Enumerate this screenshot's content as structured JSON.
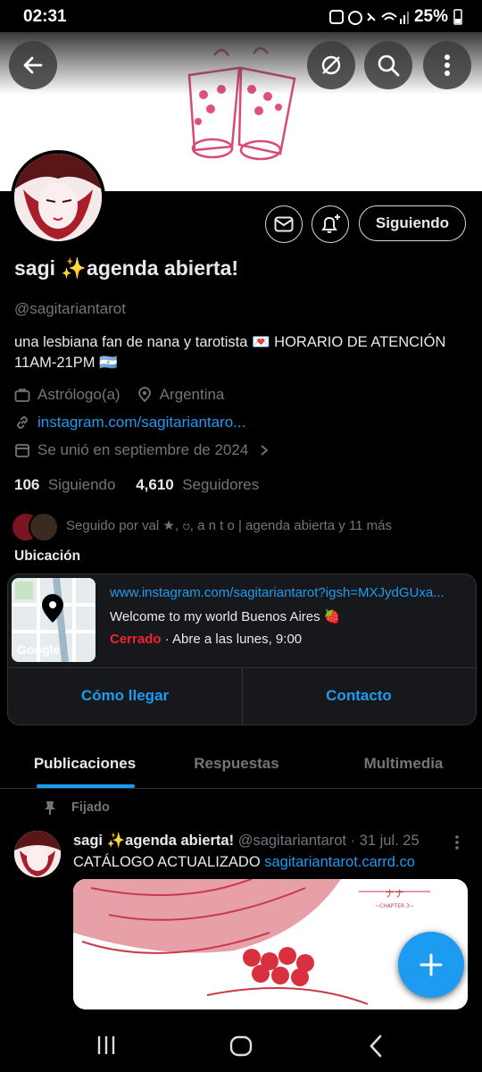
{
  "status_bar": {
    "time": "02:31",
    "battery": "25%"
  },
  "profile": {
    "display_name": "sagi ✨agenda abierta!",
    "handle": "@sagitariantarot",
    "bio": "una lesbiana fan de nana y tarotista 💌 HORARIO DE ATENCIÓN 11AM-21PM 🇦🇷",
    "category": "Astrólogo(a)",
    "location": "Argentina",
    "website": "instagram.com/sagitariantaro...",
    "joined": "Se unió en septiembre de 2024",
    "following_count": "106",
    "following_label": "Siguiendo",
    "followers_count": "4,610",
    "followers_label": "Seguidores",
    "followed_by": "Seguido por val ★, ဗ, a n t o | agenda abierta y 11 más",
    "follow_button": "Siguiendo"
  },
  "location_card": {
    "section_title": "Ubicación",
    "url": "www.instagram.com/sagitariantarot?igsh=MXJydGUxa...",
    "description": "Welcome to my world  Buenos Aires 🍓",
    "status": "Cerrado",
    "hours": " · Abre a las lunes, 9:00",
    "map_label": "Google",
    "action_directions": "Cómo llegar",
    "action_contact": "Contacto"
  },
  "tabs": [
    {
      "label": "Publicaciones",
      "active": true
    },
    {
      "label": "Respuestas",
      "active": false
    },
    {
      "label": "Multimedia",
      "active": false
    }
  ],
  "pinned_post": {
    "pinned_label": "Fijado",
    "author": "sagi ✨agenda abierta!",
    "handle_date": "@sagitariantarot · 31 jul. 25",
    "text": "CATÁLOGO ACTUALIZADO ",
    "link": "sagitariantarot.carrd.co",
    "image_caption": "ナナ",
    "image_sub": "~CHAPTER 3~"
  },
  "colors": {
    "accent": "#1d9bf0",
    "closed": "#f4212e",
    "muted": "#71767b",
    "background": "#000000"
  },
  "icons": [
    "back-icon",
    "hide-icon",
    "search-icon",
    "more-icon",
    "mail-icon",
    "bell-plus-icon",
    "briefcase-icon",
    "location-pin-icon",
    "link-icon",
    "calendar-icon",
    "pin-icon",
    "plus-icon"
  ]
}
